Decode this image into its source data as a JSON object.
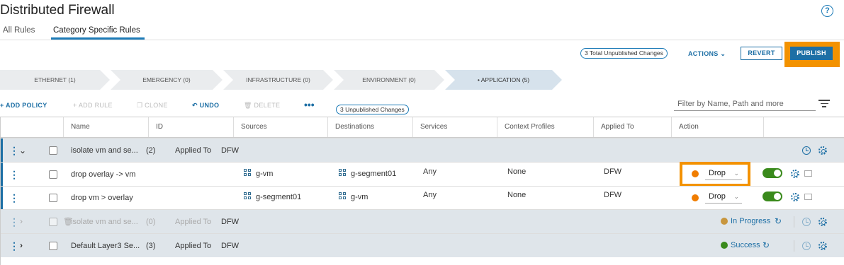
{
  "page": {
    "title": "Distributed Firewall",
    "help_glyph": "?"
  },
  "tabs": [
    {
      "label": "All Rules"
    },
    {
      "label": "Category Specific Rules",
      "active": true
    }
  ],
  "top_bar": {
    "total_unpublished": "3 Total Unpublished Changes",
    "actions_label": "ACTIONS",
    "revert_label": "REVERT",
    "publish_label": "PUBLISH"
  },
  "categories": [
    {
      "label": "ETHERNET (1)"
    },
    {
      "label": "EMERGENCY (0)"
    },
    {
      "label": "INFRASTRUCTURE (0)"
    },
    {
      "label": "ENVIRONMENT (0)"
    },
    {
      "label": "• APPLICATION (5)",
      "active": true
    }
  ],
  "toolbar": {
    "add_policy": "ADD POLICY",
    "add_rule": "ADD RULE",
    "clone": "CLONE",
    "undo": "UNDO",
    "delete": "DELETE",
    "more": "•••",
    "unpublished": "3 Unpublished Changes",
    "filter_placeholder": "Filter by Name, Path and more"
  },
  "columns": [
    "Name",
    "ID",
    "Sources",
    "Destinations",
    "Services",
    "Context Profiles",
    "Applied To",
    "Action"
  ],
  "rows": [
    {
      "kind": "policy",
      "name": "isolate vm and se...",
      "count": "(2)",
      "applied_label": "Applied To",
      "applied_value": "DFW",
      "expanded": true
    },
    {
      "kind": "rule",
      "name": "drop overlay -> vm",
      "source": "g-vm",
      "destination": "g-segment01",
      "service": "Any",
      "context": "None",
      "applied": "DFW",
      "action": "Drop"
    },
    {
      "kind": "rule",
      "name": "drop vm > overlay",
      "source": "g-segment01",
      "destination": "g-vm",
      "service": "Any",
      "context": "None",
      "applied": "DFW",
      "action": "Drop"
    },
    {
      "kind": "policy",
      "name": "isolate vm and se...",
      "count": "(0)",
      "applied_label": "Applied To",
      "applied_value": "DFW",
      "status": "In Progress",
      "status_color": "#c8963e",
      "disabled": true
    },
    {
      "kind": "policy",
      "name": "Default Layer3 Se...",
      "count": "(3)",
      "applied_label": "Applied To",
      "applied_value": "DFW",
      "status": "Success",
      "status_color": "#3a8a1c"
    }
  ],
  "colors": {
    "accent": "#1d6fa5",
    "highlight": "#f39200",
    "drop_dot": "#f07d00",
    "toggle_on": "#3a8a1c"
  }
}
